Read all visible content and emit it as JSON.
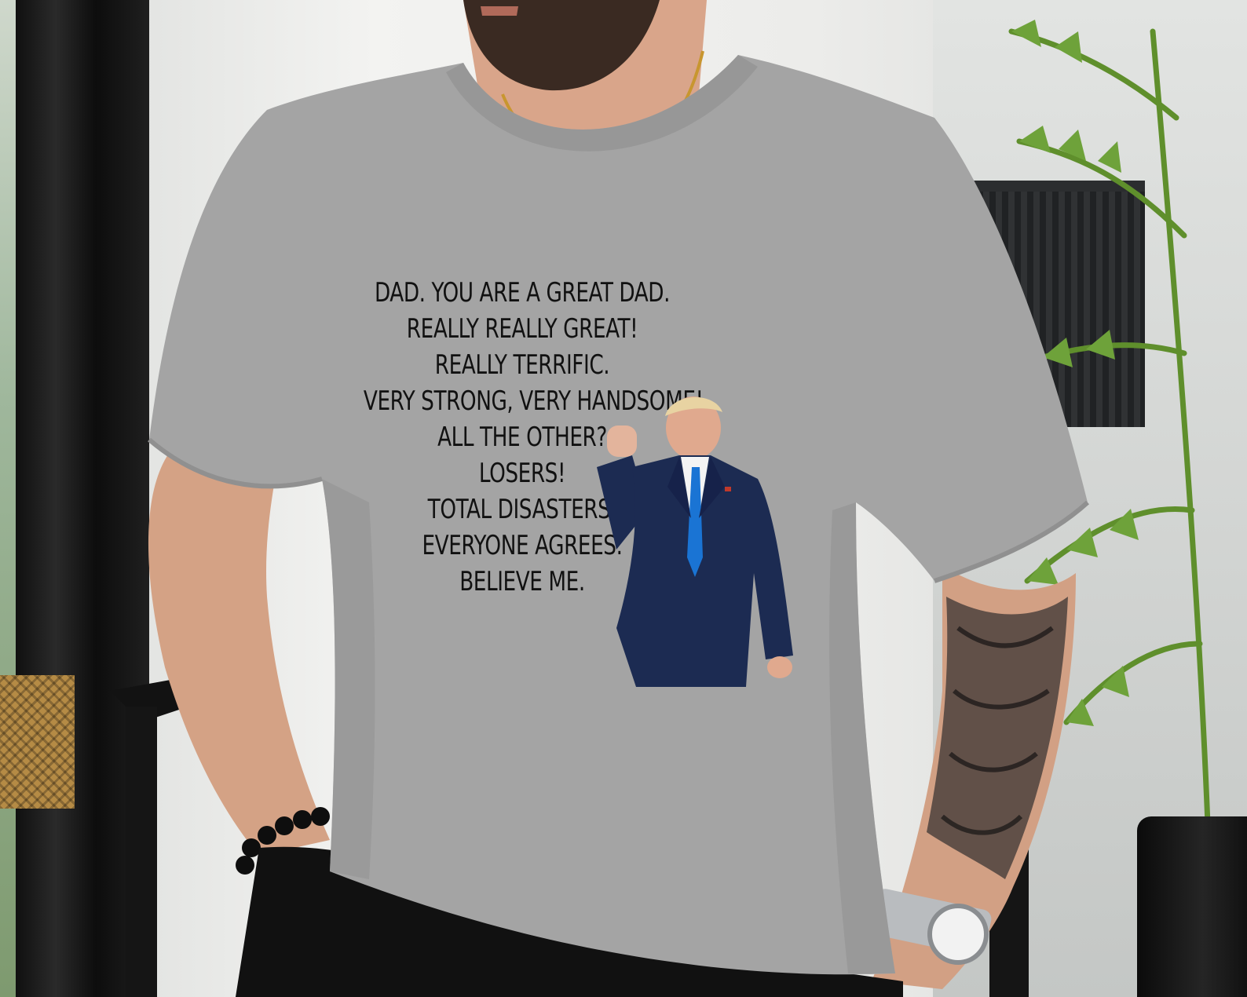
{
  "shirt_print": {
    "lines": [
      "DAD. YOU ARE A GREAT DAD.",
      "REALLY REALLY GREAT!",
      "REALLY TERRIFIC.",
      "VERY STRONG, VERY HANDSOME!",
      "ALL THE OTHER?",
      "LOSERS!",
      "TOTAL DISASTERS.",
      "EVERYONE AGREES.",
      "BELIEVE ME."
    ]
  },
  "colors": {
    "shirt": "#a4a4a4",
    "print_text": "#111111",
    "suit": "#1c2b52",
    "tie": "#1a74d4",
    "skin": "#d9a58a",
    "pants": "#111111"
  }
}
